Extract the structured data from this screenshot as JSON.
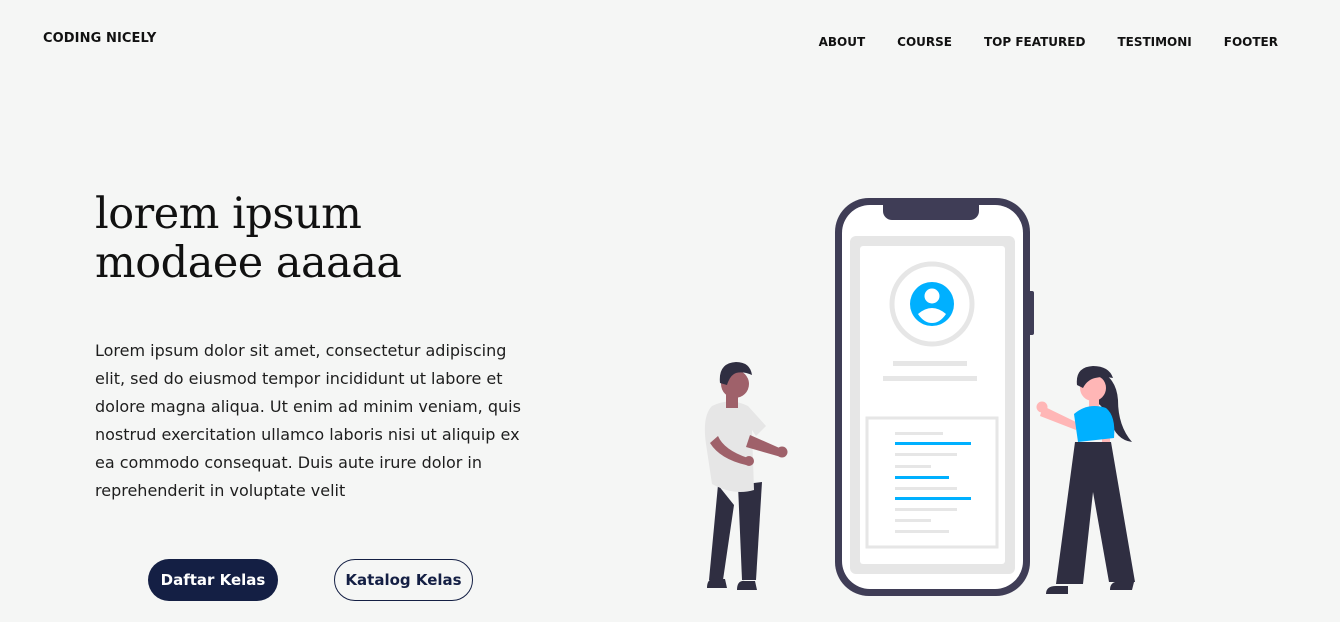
{
  "brand": "CODING NICELY",
  "nav": {
    "items": [
      "ABOUT",
      "COURSE",
      "TOP FEATURED",
      "TESTIMONI",
      "FOOTER"
    ]
  },
  "hero": {
    "title_line1": "lorem ipsum",
    "title_line2": "modaee aaaaa",
    "description": "Lorem ipsum dolor sit amet, consectetur adipiscing elit, sed do eiusmod tempor incididunt ut labore et dolore magna aliqua. Ut enim ad minim veniam, quis nostrud exercitation ullamco laboris nisi ut aliquip ex ea commodo consequat. Duis aute irure dolor in reprehenderit in voluptate velit",
    "primary_button": "Daftar Kelas",
    "secondary_button": "Katalog Kelas"
  },
  "colors": {
    "background": "#f5f6f5",
    "button_primary": "#141f44",
    "accent": "#00b0ff",
    "phone_frame": "#3f3d56"
  },
  "illustration": {
    "icons": [
      "smartphone-icon",
      "user-avatar-icon",
      "man-figure",
      "woman-figure"
    ]
  }
}
